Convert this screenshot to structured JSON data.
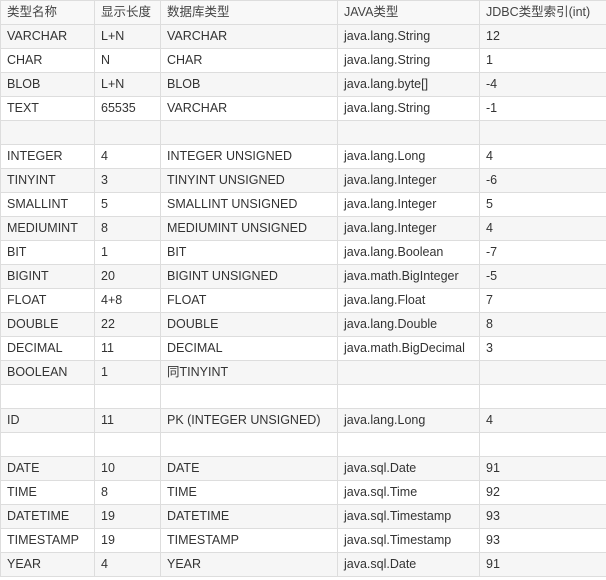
{
  "table": {
    "headers": [
      "类型名称",
      "显示长度",
      "数据库类型",
      "JAVA类型",
      "JDBC类型索引(int)"
    ],
    "rows": [
      [
        "VARCHAR",
        "L+N",
        "VARCHAR",
        "java.lang.String",
        "12"
      ],
      [
        "CHAR",
        "N",
        "CHAR",
        "java.lang.String",
        "1"
      ],
      [
        "BLOB",
        "L+N",
        "BLOB",
        "java.lang.byte[]",
        "-4"
      ],
      [
        "TEXT",
        "65535",
        "VARCHAR",
        "java.lang.String",
        "-1"
      ],
      [
        "",
        "",
        "",
        "",
        ""
      ],
      [
        "INTEGER",
        "4",
        "INTEGER UNSIGNED",
        "java.lang.Long",
        "4"
      ],
      [
        "TINYINT",
        "3",
        "TINYINT UNSIGNED",
        "java.lang.Integer",
        "-6"
      ],
      [
        "SMALLINT",
        "5",
        "SMALLINT UNSIGNED",
        "java.lang.Integer",
        "5"
      ],
      [
        "MEDIUMINT",
        "8",
        "MEDIUMINT UNSIGNED",
        "java.lang.Integer",
        "4"
      ],
      [
        "BIT",
        "1",
        "BIT",
        "java.lang.Boolean",
        "-7"
      ],
      [
        "BIGINT",
        "20",
        "BIGINT UNSIGNED",
        "java.math.BigInteger",
        "-5"
      ],
      [
        "FLOAT",
        "4+8",
        "FLOAT",
        "java.lang.Float",
        "7"
      ],
      [
        "DOUBLE",
        "22",
        "DOUBLE",
        "java.lang.Double",
        "8"
      ],
      [
        "DECIMAL",
        "11",
        "DECIMAL",
        "java.math.BigDecimal",
        "3"
      ],
      [
        "BOOLEAN",
        "1",
        "同TINYINT",
        "",
        ""
      ],
      [
        "",
        "",
        "",
        "",
        ""
      ],
      [
        "ID",
        "11",
        "PK (INTEGER UNSIGNED)",
        "java.lang.Long",
        "4"
      ],
      [
        "",
        "",
        "",
        "",
        ""
      ],
      [
        "DATE",
        "10",
        "DATE",
        "java.sql.Date",
        "91"
      ],
      [
        "TIME",
        "8",
        "TIME",
        "java.sql.Time",
        "92"
      ],
      [
        "DATETIME",
        "19",
        "DATETIME",
        "java.sql.Timestamp",
        "93"
      ],
      [
        "TIMESTAMP",
        "19",
        "TIMESTAMP",
        "java.sql.Timestamp",
        "93"
      ],
      [
        "YEAR",
        "4",
        "YEAR",
        "java.sql.Date",
        "91"
      ]
    ]
  }
}
